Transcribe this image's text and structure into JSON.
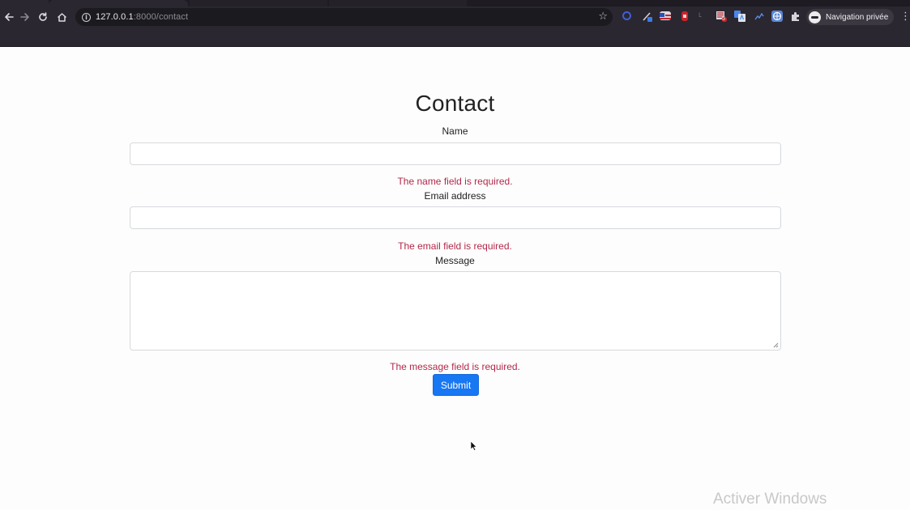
{
  "browser": {
    "url_host": "127.0.0.1",
    "url_rest": ":8000/contact",
    "profile_label": "Navigation privée",
    "extension_badge": "5",
    "colors": {
      "frame": "#2a2730",
      "omnibox": "#1b1a1f"
    }
  },
  "page": {
    "title": "Contact",
    "fields": {
      "name": {
        "label": "Name",
        "value": "",
        "error": "The name field is required."
      },
      "email": {
        "label": "Email address",
        "value": "",
        "error": "The email field is required."
      },
      "message": {
        "label": "Message",
        "value": "",
        "error": "The message field is required."
      }
    },
    "submit_label": "Submit",
    "colors": {
      "error": "#b3294a",
      "button": "#1877f2"
    }
  },
  "overlay": {
    "watermark": "Activer Windows"
  }
}
